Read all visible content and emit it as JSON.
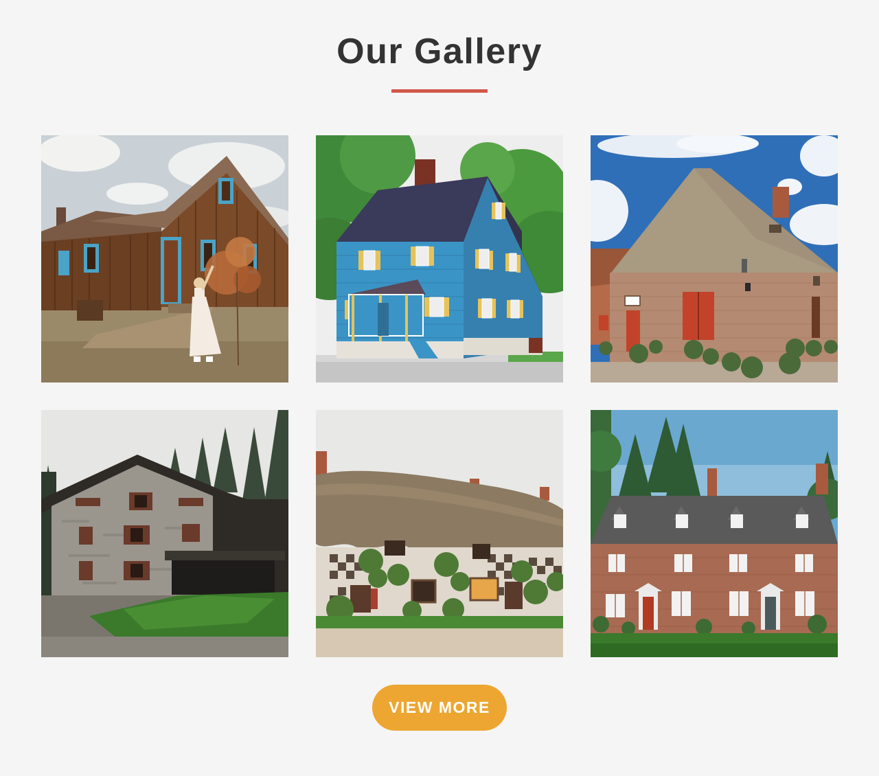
{
  "gallery": {
    "title": "Our Gallery",
    "accent_color": "#d2584a",
    "photos": [
      {
        "subject": "wooden cabin with blue trim and woman in white dress"
      },
      {
        "subject": "blue clapboard house with yellow shutters"
      },
      {
        "subject": "brick farmhouse with thatched roof and red doors"
      },
      {
        "subject": "stone house in pine forest"
      },
      {
        "subject": "thatched cottage with checkered flint wall"
      },
      {
        "subject": "brick manor house with dormer windows"
      }
    ],
    "view_more_label": "VIEW MORE",
    "button_color": "#eca631"
  }
}
